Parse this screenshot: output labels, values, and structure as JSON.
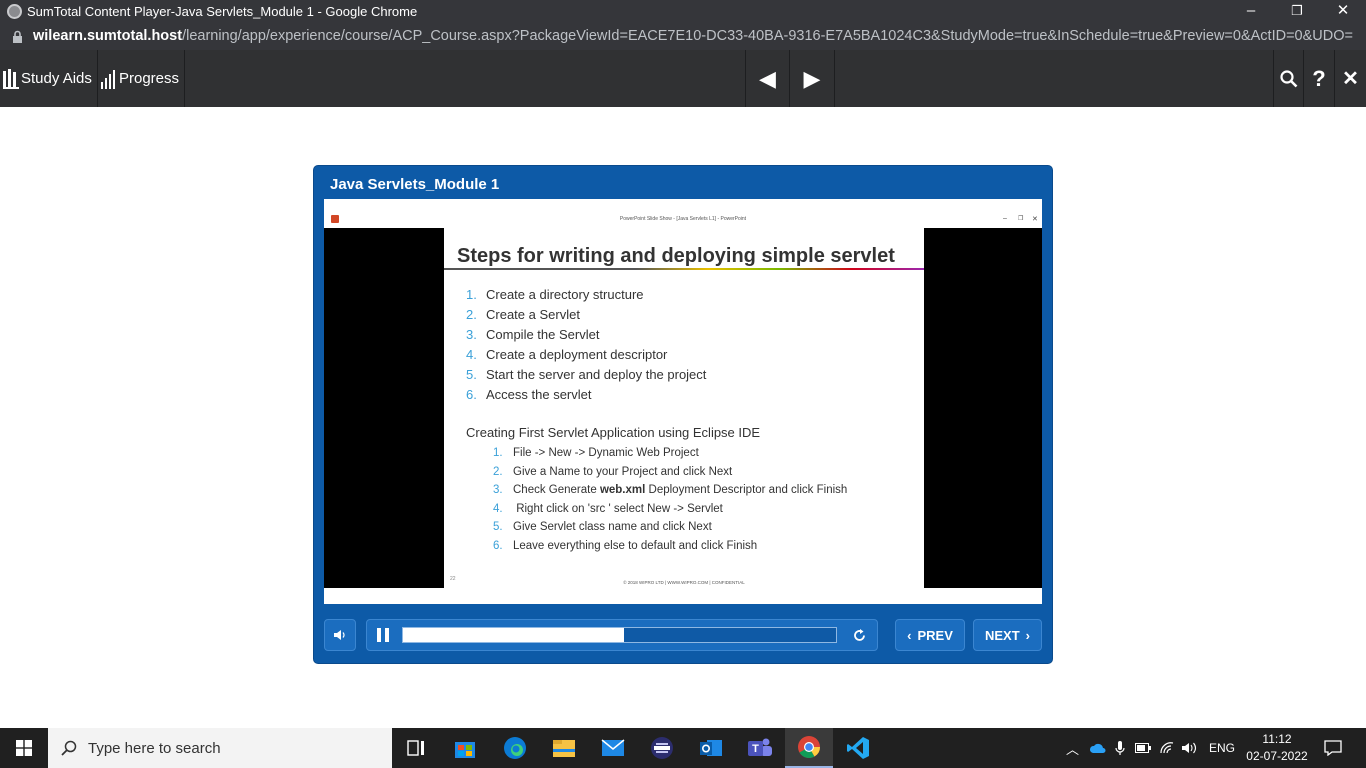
{
  "browser": {
    "title": "SumTotal Content Player-Java Servlets_Module 1 - Google Chrome",
    "url_host": "wilearn.sumtotal.host",
    "url_path": "/learning/app/experience/course/ACP_Course.aspx?PackageViewId=EACE7E10-DC33-40BA-9316-E7A5BA1024C3&StudyMode=true&InSchedule=true&Preview=0&ActID=0&UDO=true&Att...",
    "minimize": "–",
    "restore": "❐",
    "close": "✕"
  },
  "toolbar": {
    "study_aids": "Study Aids",
    "progress": "Progress",
    "prev_icon": "◀",
    "next_icon": "▶",
    "search_icon": "search-icon",
    "help": "?",
    "close": "✕"
  },
  "player": {
    "title": "Java Servlets_Module 1",
    "ppt_title": "PowerPoint Slide Show - [Java Servlets L1] - PowerPoint",
    "progress_fraction": 0.51,
    "prev_label": "PREV",
    "next_label": "NEXT"
  },
  "slide": {
    "heading": "Steps for writing and deploying simple servlet",
    "steps": [
      {
        "num": "1.",
        "text": "Create a directory structure"
      },
      {
        "num": "2.",
        "text": "Create a Servlet"
      },
      {
        "num": "3.",
        "text": "Compile the Servlet"
      },
      {
        "num": "4.",
        "text": "Create a deployment descriptor"
      },
      {
        "num": "5.",
        "text": "Start the server and deploy the project"
      },
      {
        "num": "6.",
        "text": "Access the servlet"
      }
    ],
    "subheading": "Creating First Servlet Application using Eclipse IDE",
    "substeps": [
      {
        "num": "1.",
        "pre": "File -> New -> Dynamic Web Project",
        "bold": "",
        "post": ""
      },
      {
        "num": "2.",
        "pre": "Give a Name to your Project and click Next",
        "bold": "",
        "post": ""
      },
      {
        "num": "3.",
        "pre": "Check Generate ",
        "bold": "web.xml",
        "post": " Deployment Descriptor and click Finish"
      },
      {
        "num": "4.",
        "pre": " Right click on 'src ' select New -> Servlet",
        "bold": "",
        "post": ""
      },
      {
        "num": "5.",
        "pre": "Give Servlet class name and click Next",
        "bold": "",
        "post": ""
      },
      {
        "num": "6.",
        "pre": "Leave everything else to default and click Finish",
        "bold": "",
        "post": ""
      }
    ],
    "page_number": "22",
    "footer": "© 2018 WIPRO LTD  |  WWW.WIPRO.COM  |  CONFIDENTIAL"
  },
  "taskbar": {
    "search_placeholder": "Type here to search",
    "lang": "ENG",
    "time": "11:12",
    "date": "02-07-2022"
  }
}
